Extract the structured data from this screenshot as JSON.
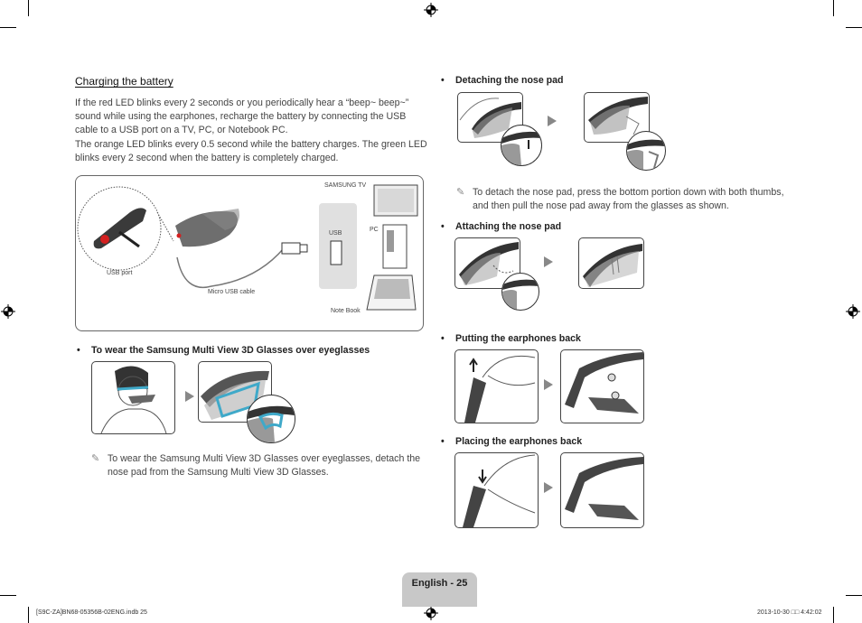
{
  "left": {
    "section_title": "Charging the battery",
    "paragraphs": [
      "If the red LED blinks every 2 seconds or you periodically hear a “beep~ beep~” sound while using the earphones, recharge the battery by connecting the USB cable to a USB port on a TV, PC, or Notebook PC.",
      "The orange LED blinks every 0.5 second while the battery charges. The green LED blinks every 2 second when the battery is completely charged."
    ],
    "diagram": {
      "labels": {
        "usb_port": "USB port",
        "micro_usb_cable": "Micro USB cable",
        "samsung_tv": "SAMSUNG TV",
        "usb": "USB",
        "pc": "PC",
        "note_book": "Note Book"
      }
    },
    "over_eyeglasses": {
      "bullet": "To wear the Samsung Multi View 3D Glasses over eyeglasses",
      "note": "To wear the Samsung Multi View 3D Glasses over eyeglasses, detach the nose pad from the Samsung Multi View 3D Glasses."
    }
  },
  "right": {
    "detaching": {
      "bullet": "Detaching the nose pad",
      "note": "To detach the nose pad, press the bottom portion down with both thumbs, and then pull the nose pad away from the glasses as shown."
    },
    "attaching": {
      "bullet": "Attaching the nose pad"
    },
    "putting_back": {
      "bullet": "Putting the earphones back"
    },
    "placing_back": {
      "bullet": "Placing the earphones back"
    }
  },
  "footer": {
    "page_label": "English - 25",
    "file_slug": "[S9C-ZA]BN68-05356B-02ENG.indb   25",
    "timestamp": "2013-10-30   □□ 4:42:02"
  },
  "symbols": {
    "bullet": "•",
    "note_icon": "✎"
  },
  "colors": {
    "accent_blue": "#3fa9c9",
    "red_led": "#d42020",
    "footer_tab": "#c8c8c8"
  }
}
